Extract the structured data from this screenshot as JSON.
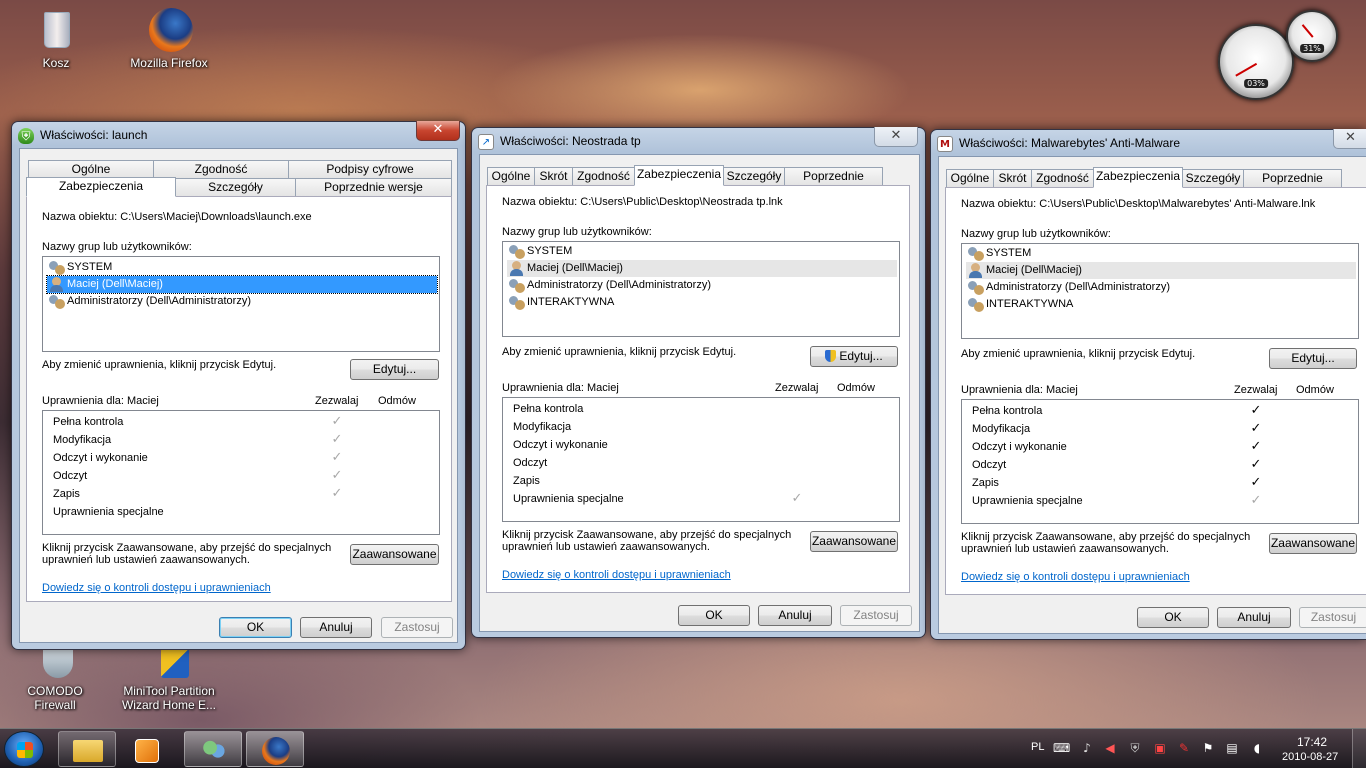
{
  "desktop": {
    "icons": [
      {
        "label": "Kosz"
      },
      {
        "label": "Mozilla Firefox"
      },
      {
        "label": "COMODO Firewall"
      },
      {
        "label": "MiniTool Partition Wizard Home E..."
      }
    ],
    "gadget": {
      "cpu_reading": "03%",
      "mem_reading": "31%"
    }
  },
  "dialogs": [
    {
      "title": "Właściwości: launch",
      "tabs_row1": [
        "Ogólne",
        "Zgodność",
        "Podpisy cyfrowe"
      ],
      "tabs_row2": [
        "Zabezpieczenia",
        "Szczegóły",
        "Poprzednie wersje"
      ],
      "object_label": "Nazwa obiektu:",
      "object_name": "C:\\Users\\Maciej\\Downloads\\launch.exe",
      "groups_label": "Nazwy grup lub użytkowników:",
      "users": [
        "SYSTEM",
        "Maciej (Dell\\Maciej)",
        "Administratorzy (Dell\\Administratorzy)"
      ],
      "change_text": "Aby zmienić uprawnienia, kliknij przycisk Edytuj.",
      "edit_button": "Edytuj...",
      "perm_for": "Uprawnienia dla: Maciej",
      "allow_header": "Zezwalaj",
      "deny_header": "Odmów",
      "permissions": [
        "Pełna kontrola",
        "Modyfikacja",
        "Odczyt i wykonanie",
        "Odczyt",
        "Zapis",
        "Uprawnienia specjalne"
      ],
      "advanced_text_1": "Kliknij przycisk Zaawansowane, aby przejść do specjalnych",
      "advanced_text_2": "uprawnień lub ustawień zaawansowanych.",
      "advanced_button": "Zaawansowane",
      "learn_link": "Dowiedz się o kontroli dostępu i uprawnieniach",
      "ok": "OK",
      "cancel": "Anuluj",
      "apply": "Zastosuj"
    },
    {
      "title": "Właściwości: Neostrada tp",
      "tabs": [
        "Ogólne",
        "Skrót",
        "Zgodność",
        "Zabezpieczenia",
        "Szczegóły",
        "Poprzednie wersje"
      ],
      "object_label": "Nazwa obiektu:",
      "object_name": "C:\\Users\\Public\\Desktop\\Neostrada tp.lnk",
      "groups_label": "Nazwy grup lub użytkowników:",
      "users": [
        "SYSTEM",
        "Maciej (Dell\\Maciej)",
        "Administratorzy (Dell\\Administratorzy)",
        "INTERAKTYWNA"
      ],
      "change_text": "Aby zmienić uprawnienia, kliknij przycisk Edytuj.",
      "edit_button": "Edytuj...",
      "perm_for": "Uprawnienia dla: Maciej",
      "allow_header": "Zezwalaj",
      "deny_header": "Odmów",
      "permissions": [
        "Pełna kontrola",
        "Modyfikacja",
        "Odczyt i wykonanie",
        "Odczyt",
        "Zapis",
        "Uprawnienia specjalne"
      ],
      "advanced_text_1": "Kliknij przycisk Zaawansowane, aby przejść do specjalnych",
      "advanced_text_2": "uprawnień lub ustawień zaawansowanych.",
      "advanced_button": "Zaawansowane",
      "learn_link": "Dowiedz się o kontroli dostępu i uprawnieniach",
      "ok": "OK",
      "cancel": "Anuluj",
      "apply": "Zastosuj"
    },
    {
      "title": "Właściwości: Malwarebytes' Anti-Malware",
      "tabs": [
        "Ogólne",
        "Skrót",
        "Zgodność",
        "Zabezpieczenia",
        "Szczegóły",
        "Poprzednie wersje"
      ],
      "object_label": "Nazwa obiektu:",
      "object_name": "C:\\Users\\Public\\Desktop\\Malwarebytes' Anti-Malware.lnk",
      "groups_label": "Nazwy grup lub użytkowników:",
      "users": [
        "SYSTEM",
        "Maciej (Dell\\Maciej)",
        "Administratorzy (Dell\\Administratorzy)",
        "INTERAKTYWNA"
      ],
      "change_text": "Aby zmienić uprawnienia, kliknij przycisk Edytuj.",
      "edit_button": "Edytuj...",
      "perm_for": "Uprawnienia dla: Maciej",
      "allow_header": "Zezwalaj",
      "deny_header": "Odmów",
      "permissions": [
        "Pełna kontrola",
        "Modyfikacja",
        "Odczyt i wykonanie",
        "Odczyt",
        "Zapis",
        "Uprawnienia specjalne"
      ],
      "advanced_text_1": "Kliknij przycisk Zaawansowane, aby przejść do specjalnych",
      "advanced_text_2": "uprawnień lub ustawień zaawansowanych.",
      "advanced_button": "Zaawansowane",
      "learn_link": "Dowiedz się o kontroli dostępu i uprawnieniach",
      "ok": "OK",
      "cancel": "Anuluj",
      "apply": "Zastosuj"
    }
  ],
  "taskbar": {
    "language": "PL",
    "time": "17:42",
    "date": "2010-08-27"
  },
  "icons": {
    "check": "✓",
    "close": "✕",
    "shield": "⛨"
  },
  "colors": {
    "selection": "#3399ff",
    "link": "#0066cc",
    "close_red": "#c8452f"
  }
}
